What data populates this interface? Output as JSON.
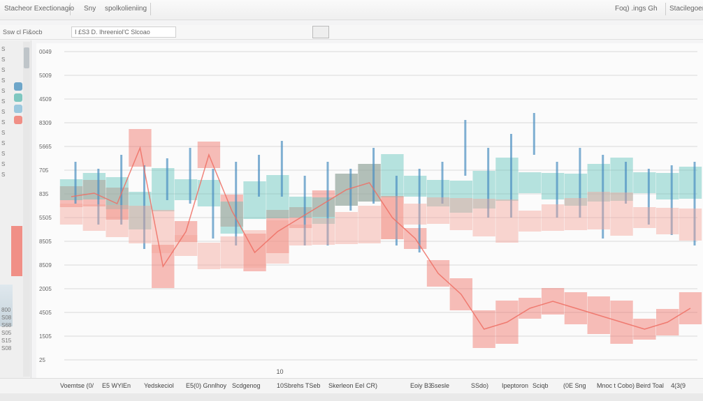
{
  "window": {
    "menu": [
      "Stacheor Exectionagio",
      "Sny",
      "spolkolieniing",
      "Foq) .ings Gh",
      "Stacilegoen"
    ]
  },
  "toolbar": {
    "left_label": "Ssw cl Fi&ocb",
    "field_value": "I £S3 D. Ihreeniol'C Slcoao"
  },
  "sidebar": {
    "ticks": [
      "S",
      "S",
      "S",
      "S",
      "S",
      "S",
      "S",
      "S",
      "S",
      "S",
      "S",
      "S",
      "S"
    ],
    "lower_ticks": [
      "800",
      "S08",
      "S68",
      "S05",
      "S15",
      "S08"
    ],
    "swatch_colors": [
      "#6ea6c9",
      "#7fc7c0",
      "#9cc8de",
      "#f08f86"
    ]
  },
  "colors": {
    "red": "#ef6e64",
    "salmon": "#f5a39a",
    "teal": "#5fc4bb",
    "blue": "#4b8fc2",
    "grid": "#d9d9d9"
  },
  "chart_data": {
    "type": "line",
    "title": "",
    "xlabel": "10",
    "ylabel": "",
    "y_ticks": [
      "0049",
      "5009",
      "4509",
      "8309",
      "5665",
      "705",
      "835",
      "5505",
      "8505",
      "8509",
      "2005",
      "4505",
      "1505",
      "25"
    ],
    "note": "colors per series are taken from the picture; values are read from relative positions on the plot",
    "series": [
      {
        "color": "#ef6e64",
        "style": "band",
        "values": [
          220,
          215,
          230,
          150,
          320,
          270,
          160,
          240,
          300,
          270,
          250,
          230,
          210,
          200,
          250,
          280,
          330,
          360,
          410,
          400,
          380,
          370,
          380,
          390,
          400,
          410,
          400,
          380
        ]
      },
      {
        "color": "#5fc4bb",
        "style": "band",
        "values": [
          210,
          205,
          215,
          240,
          210,
          210,
          215,
          250,
          225,
          220,
          235,
          240,
          210,
          200,
          190,
          205,
          215,
          220,
          210,
          195,
          200,
          205,
          210,
          200,
          195,
          200,
          205,
          200
        ]
      },
      {
        "color": "#4b8fc2",
        "style": "spikes",
        "values": [
          170,
          180,
          160,
          175,
          165,
          150,
          180,
          170,
          160,
          140,
          190,
          170,
          180,
          150,
          190,
          180,
          170,
          110,
          150,
          130,
          100,
          170,
          150,
          160,
          170,
          180,
          175,
          170
        ]
      },
      {
        "color": "#f5a39a",
        "style": "band",
        "values": [
          245,
          250,
          255,
          260,
          270,
          290,
          305,
          300,
          295,
          285,
          275,
          270,
          265,
          260,
          250,
          245,
          240,
          245,
          250,
          255,
          255,
          250,
          245,
          240,
          245,
          250,
          255,
          260
        ]
      }
    ]
  },
  "status": {
    "labels": [
      "Voemtse (0/",
      "E5 WYlEn",
      "Yedskeciol",
      "E5(0) Gnnlhoy",
      "Scdgenog",
      "10",
      "Sbrehs TSeb",
      "Skerleon EeI CR)",
      "Eoiy B3",
      "Ssesle",
      "SSdo)",
      "Ipeptoron",
      "Sciqb",
      "(0E Sng",
      "Mnoc t Cobo)",
      "Beird Toal",
      "4(3(9"
    ]
  }
}
